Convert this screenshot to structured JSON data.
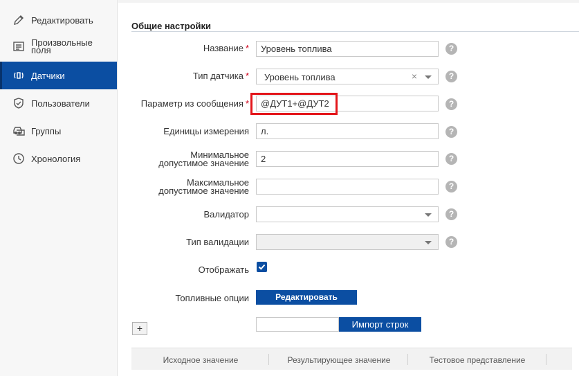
{
  "sidebar": {
    "items": [
      {
        "label": "Редактировать",
        "icon": "pencil-icon"
      },
      {
        "label": "Произвольные поля",
        "icon": "list-icon"
      },
      {
        "label": "Датчики",
        "icon": "sensor-icon",
        "active": true
      },
      {
        "label": "Пользователи",
        "icon": "shield-icon"
      },
      {
        "label": "Группы",
        "icon": "cars-icon"
      },
      {
        "label": "Хронология",
        "icon": "clock-icon"
      }
    ]
  },
  "section": {
    "title": "Общие настройки"
  },
  "form": {
    "name": {
      "label": "Название",
      "value": "Уровень топлива"
    },
    "sensor_type": {
      "label": "Тип датчика",
      "value": "Уровень топлива"
    },
    "param": {
      "label": "Параметр из сообщения",
      "value": "@ДУТ1+@ДУТ2"
    },
    "units": {
      "label": "Единицы измерения",
      "value": "л."
    },
    "min": {
      "label": "Минимальное допустимое значение",
      "value": "2"
    },
    "max": {
      "label": "Максимальное допустимое значение",
      "value": ""
    },
    "validator": {
      "label": "Валидатор",
      "value": ""
    },
    "validation_type": {
      "label": "Тип валидации",
      "value": ""
    },
    "display": {
      "label": "Отображать",
      "checked": true
    },
    "fuel_options": {
      "label": "Топливные опции",
      "button": "Редактировать"
    }
  },
  "help_symbol": "?",
  "required_mark": "*",
  "add_symbol": "+",
  "import": {
    "button": "Импорт строк",
    "value": ""
  },
  "table": {
    "columns": [
      "Исходное значение",
      "Результирующее значение",
      "Тестовое представление"
    ]
  },
  "colors": {
    "accent": "#0b4ea2",
    "highlight": "#e3151a",
    "required": "#d0021b"
  }
}
